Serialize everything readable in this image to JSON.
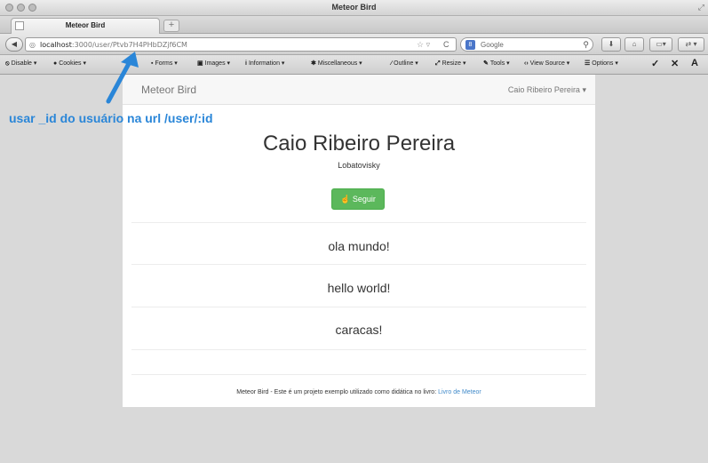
{
  "window": {
    "title": "Meteor Bird"
  },
  "tab": {
    "label": "Meteor Bird",
    "new_tab": "+"
  },
  "navbar": {
    "back": "◀",
    "url_host": "localhost",
    "url_path": ":3000/user/Ptvb7H4PHbDZjf6CM",
    "search_placeholder": "Google",
    "search_engine": "8"
  },
  "devbar": {
    "items": [
      "Disable",
      "Cookies",
      "Forms",
      "Images",
      "Information",
      "Miscellaneous",
      "Outline",
      "Resize",
      "Tools",
      "View Source",
      "Options"
    ],
    "check": "✓",
    "close": "✕",
    "warn": "A"
  },
  "app": {
    "brand": "Meteor Bird",
    "user_menu": "Caio Ribeiro Pereira",
    "profile_name": "Caio Ribeiro Pereira",
    "username": "Lobatovisky",
    "follow_label": "Seguir",
    "posts": [
      "ola mundo!",
      "hello world!",
      "caracas!"
    ],
    "footer_text": "Meteor Bird - Este é um projeto exemplo utilizado como didática no livro: ",
    "footer_link": "Livro de Meteor"
  },
  "annotation": {
    "text": "usar _id do usuário na url /user/:id",
    "color": "#2a86d8"
  }
}
